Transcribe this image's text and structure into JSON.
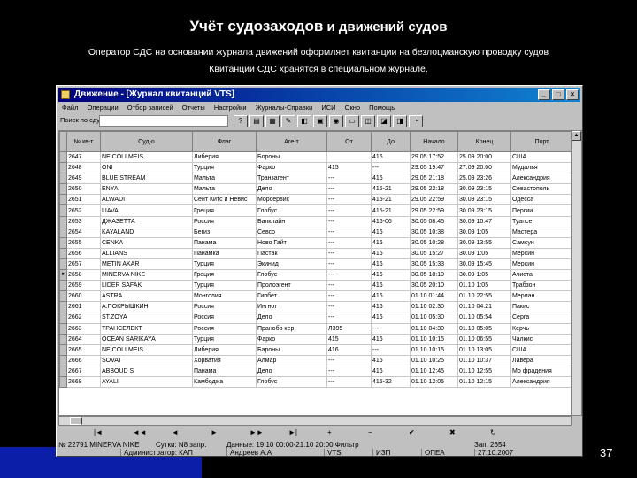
{
  "slide": {
    "title_part1": "Учёт судозаходов",
    "title_part2": " и движений судов",
    "line1": "Оператор СДС на основании журнала движений оформляет квитанции на безлоцманскую проводку судов",
    "line2": "Квитанции СДС хранятся в специальном журнале.",
    "page_number": "37"
  },
  "window": {
    "title": "Движение - [Журнал квитанций VTS]",
    "controls": [
      "_",
      "□",
      "×"
    ],
    "menu": [
      "Файл",
      "Операции",
      "Отбор записей",
      "Отчеты",
      "Настройки",
      "Журналы-Справки",
      "ИСИ",
      "Окно",
      "Помощь"
    ],
    "search_label": "Поиск по сдуч"
  },
  "table": {
    "headers": [
      "№ кв-т",
      "Суд-о",
      "Флаг",
      "Аге-т",
      "От",
      "До",
      "Начало",
      "Конец",
      "Порт"
    ],
    "rows": [
      [
        "2647",
        "NE COLLMEIS",
        "Либерия",
        "Бороны",
        "",
        "416",
        "29.05 17:52",
        "25.09 20:00",
        "США"
      ],
      [
        "2648",
        "ONI",
        "Турция",
        "Фарко",
        "415",
        "---",
        "29.05 19:47",
        "27.09 20:00",
        "Мудалья"
      ],
      [
        "2649",
        "BLUE STREAM",
        "Мальта",
        "Транзагент",
        "---",
        "416",
        "29.05 21:18",
        "25.09 23:26",
        "Александрия"
      ],
      [
        "2650",
        "ENYA",
        "Мальта",
        "Дело",
        "---",
        "415-21",
        "29.05 22:18",
        "30.09 23:15",
        "Севастополь"
      ],
      [
        "2651",
        "ALWADI",
        "Сент Китс и Невис",
        "Морсервис",
        "---",
        "415-21",
        "29.05 22:59",
        "30.09 23:15",
        "Одесса"
      ],
      [
        "2652",
        "LIAVA",
        "Греция",
        "Глобус",
        "---",
        "415-21",
        "29.05 22:59",
        "30.09 23:15",
        "Пергии"
      ],
      [
        "2653",
        "ДЖАЗЕТТА",
        "Россия",
        "Бапклайн",
        "---",
        "416-06",
        "30.05 08:45",
        "30.09 10:47",
        "Туапсе"
      ],
      [
        "2654",
        "KAYALAND",
        "Бегиз",
        "Севсо",
        "---",
        "416",
        "30.05 10:38",
        "30.09 1:05",
        "Мастера"
      ],
      [
        "2655",
        "CENKA",
        "Панама",
        "Ново Гайт",
        "---",
        "416",
        "30.05 10:28",
        "30.09 13:55",
        "Самсун"
      ],
      [
        "2656",
        "ALLIANS",
        "Панамка",
        "Пастак",
        "---",
        "416",
        "30.05 15:27",
        "30.09 1:05",
        "Мерсин"
      ],
      [
        "2657",
        "METIN AKAR",
        "Турция",
        "Экинид",
        "---",
        "416",
        "30.05 15:33",
        "30.09 15:45",
        "Мерсин"
      ],
      [
        "2658",
        "MINERVA NIKE",
        "Греция",
        "Глобус",
        "---",
        "416",
        "30.05 18:10",
        "30.09 1:05",
        "Ачиета"
      ],
      [
        "2659",
        "LIDER SAFAK",
        "Турция",
        "Пролоэгент",
        "---",
        "416",
        "30.05 20:10",
        "01.10 1:05",
        "Трабзон"
      ],
      [
        "2660",
        "ASTRA",
        "Монголия",
        "Гипбет",
        "---",
        "416",
        "01.10 01:44",
        "01.10 22:55",
        "Мериан"
      ],
      [
        "2661",
        "А.ПОКРЫШКИН",
        "Россия",
        "Ингнот",
        "---",
        "416",
        "01.10 02:30",
        "01.10 04:21",
        "Пакис"
      ],
      [
        "2662",
        "ST.ZOYA",
        "Россия",
        "Дело",
        "---",
        "416",
        "01.10 05:30",
        "01.10 05:54",
        "Серга"
      ],
      [
        "2663",
        "ТРАНСЕЛЕКТ",
        "Россия",
        "Пранобр кер",
        "Л395",
        "---",
        "01.10 04:30",
        "01.10 05:05",
        "Керчь"
      ],
      [
        "2664",
        "OCEAN SARIKAYA",
        "Турция",
        "Фарко",
        "415",
        "416",
        "01.10 10:15",
        "01.10 06:55",
        "Чалкис"
      ],
      [
        "2665",
        "NE COLLMEIS",
        "Либерия",
        "Бароны",
        "416",
        "---",
        "01.10 10:15",
        "01.10 13:05",
        "США"
      ],
      [
        "2666",
        "SOVAT",
        "Хорватия",
        "Алмар",
        "---",
        "416",
        "01.10 10:25",
        "01.10 10:37",
        "Лавера"
      ],
      [
        "2667",
        "ABBOUD S",
        "Панама",
        "Дело",
        "---",
        "416",
        "01.10 12:45",
        "01.10 12:55",
        "Мо фрадения"
      ],
      [
        "2668",
        "AYALI",
        "Камбоджа",
        "Глобус",
        "---",
        "415-32",
        "01.10 12:05",
        "01.10 12:15",
        "Александрия"
      ]
    ],
    "current_row_indicator": "►",
    "current_row_index": 11
  },
  "toolbar_buttons": [
    "?",
    "▤",
    "▦",
    "✎",
    "◧",
    "▣",
    "◉",
    "▭",
    "◫",
    "◪",
    "◨",
    "◔"
  ],
  "navigator": [
    "|◄",
    "◄◄",
    "◄",
    "►",
    "►►",
    "►|",
    "+",
    "−",
    "✔",
    "✖",
    "↻"
  ],
  "status": {
    "record": "№ 22791 MINERVA NIKE",
    "count": "Сутки: N8 запр.",
    "filter": "Данные: 19.10 00:00-21.10 20:00 Фильтр",
    "value": "Зап. 2654",
    "admin": "Администратор: КАП",
    "operator": "Андреев А.А",
    "code": "VTS",
    "mode": "ИЗП",
    "flag": "ОПЕА",
    "date": "27.10.2007"
  },
  "colors": {
    "title_gradient_start": "#000080",
    "title_gradient_end": "#1084d0",
    "accent_blue": "#0a1ea8"
  }
}
